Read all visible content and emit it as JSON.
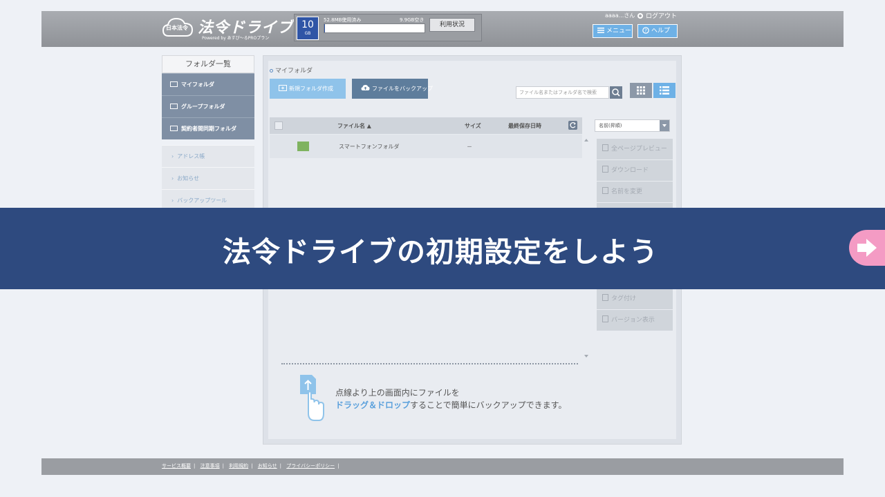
{
  "header": {
    "logo_badge": "日本法令",
    "logo_title": "法令ドライブ",
    "logo_sub": "Powered by あすぴ～るPROプラン",
    "storage": {
      "capacity": "10",
      "unit": "GB",
      "used": "52.8MB使用済み",
      "free": "9.9GB空き",
      "used_fraction": 0.005
    },
    "usage_button": "利用状況",
    "user": "aaaa...さん",
    "logout": "ログアウト",
    "menu_button": "メニュー",
    "help_button": "ヘルプ"
  },
  "sidebar": {
    "title": "フォルダ一覧",
    "folders": [
      {
        "label": "マイフォルダ"
      },
      {
        "label": "グループフォルダ"
      },
      {
        "label": "契約者間同期フォルダ"
      }
    ],
    "links": [
      {
        "label": "アドレス帳"
      },
      {
        "label": "お知らせ"
      },
      {
        "label": "バックアップツール"
      }
    ]
  },
  "main": {
    "breadcrumb": "マイフォルダ",
    "new_folder_button": "新規フォルダ作成",
    "backup_button": "ファイルをバックアップ",
    "search_placeholder": "ファイル名またはフォルダ名で検索",
    "columns": {
      "name": "ファイル名 ▲",
      "size": "サイズ",
      "modified": "最終保存日時"
    },
    "sort": "名前(昇順)",
    "rows": [
      {
        "name": "スマートフォンフォルダ",
        "size": "－",
        "modified": ""
      }
    ],
    "actions": [
      {
        "label": "全ページプレビュー"
      },
      {
        "label": "ダウンロード"
      },
      {
        "label": "名前を変更"
      },
      {
        "label": "タグ付け"
      },
      {
        "label": "バージョン表示"
      }
    ],
    "drop_line1": "点線より上の画面内にファイルを",
    "drop_highlight": "ドラッグ＆ドロップ",
    "drop_line2": "することで簡単にバックアップできます。"
  },
  "footer": {
    "links": [
      "サービス概要",
      "注意事項",
      "利用規約",
      "お知らせ",
      "プライバシーポリシー"
    ]
  },
  "overlay": {
    "title": "法令ドライブの初期設定をしよう"
  },
  "colors": {
    "banner": "#2e4a7f",
    "accent_blue": "#6eb1e6",
    "next_button": "#f49bc4"
  }
}
